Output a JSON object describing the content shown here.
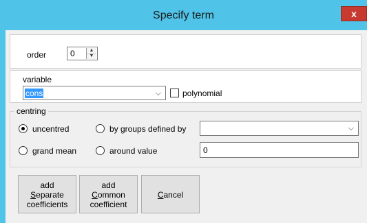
{
  "window": {
    "title": "Specify term",
    "close_label": "x",
    "accent": "#4fc3e8"
  },
  "order": {
    "label": "order",
    "value": "0"
  },
  "variable": {
    "label": "variable",
    "value": "cons",
    "polynomial_label": "polynomial",
    "polynomial_checked": false
  },
  "centring": {
    "title": "centring",
    "uncentred_label": "uncentred",
    "by_groups_label": "by groups defined by",
    "grand_mean_label": "grand mean",
    "around_value_label": "around value",
    "groups_value": "",
    "around_value": "0",
    "selected": "uncentred"
  },
  "buttons": {
    "separate": {
      "line1": "add",
      "line2_underlined": "S",
      "line2_rest": "eparate",
      "line3": "coefficients"
    },
    "common": {
      "line1": "add",
      "line2_underlined": "C",
      "line2_rest": "ommon",
      "line3": "coefficient"
    },
    "cancel": {
      "underlined": "C",
      "rest": "ancel"
    }
  }
}
